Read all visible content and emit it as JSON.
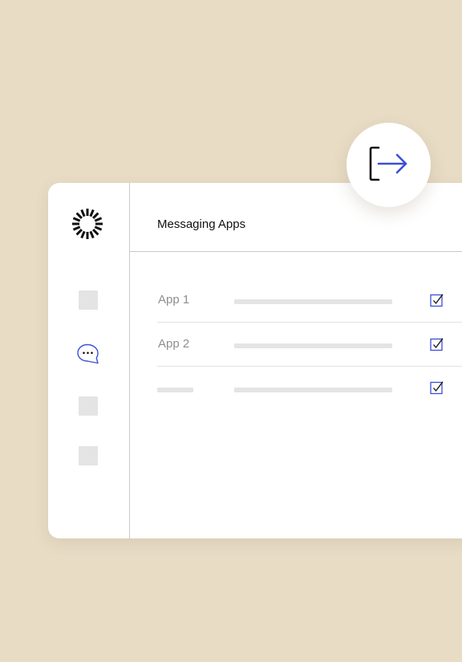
{
  "header": {
    "title": "Messaging Apps"
  },
  "sidebar": {
    "items": [
      {
        "icon": "placeholder-square"
      },
      {
        "icon": "chat-bubble-icon",
        "active": true
      },
      {
        "icon": "placeholder-square"
      },
      {
        "icon": "placeholder-square"
      }
    ]
  },
  "apps": [
    {
      "label": "App 1",
      "checked": true
    },
    {
      "label": "App 2",
      "checked": true
    },
    {
      "label": "",
      "checked": true
    }
  ],
  "exit_button": {
    "icon": "sign-out-icon"
  },
  "colors": {
    "background": "#e8dcc5",
    "accent": "#3b4fd8",
    "panel": "#ffffff",
    "placeholder": "#e4e4e4",
    "muted_text": "#8e8e8e"
  }
}
